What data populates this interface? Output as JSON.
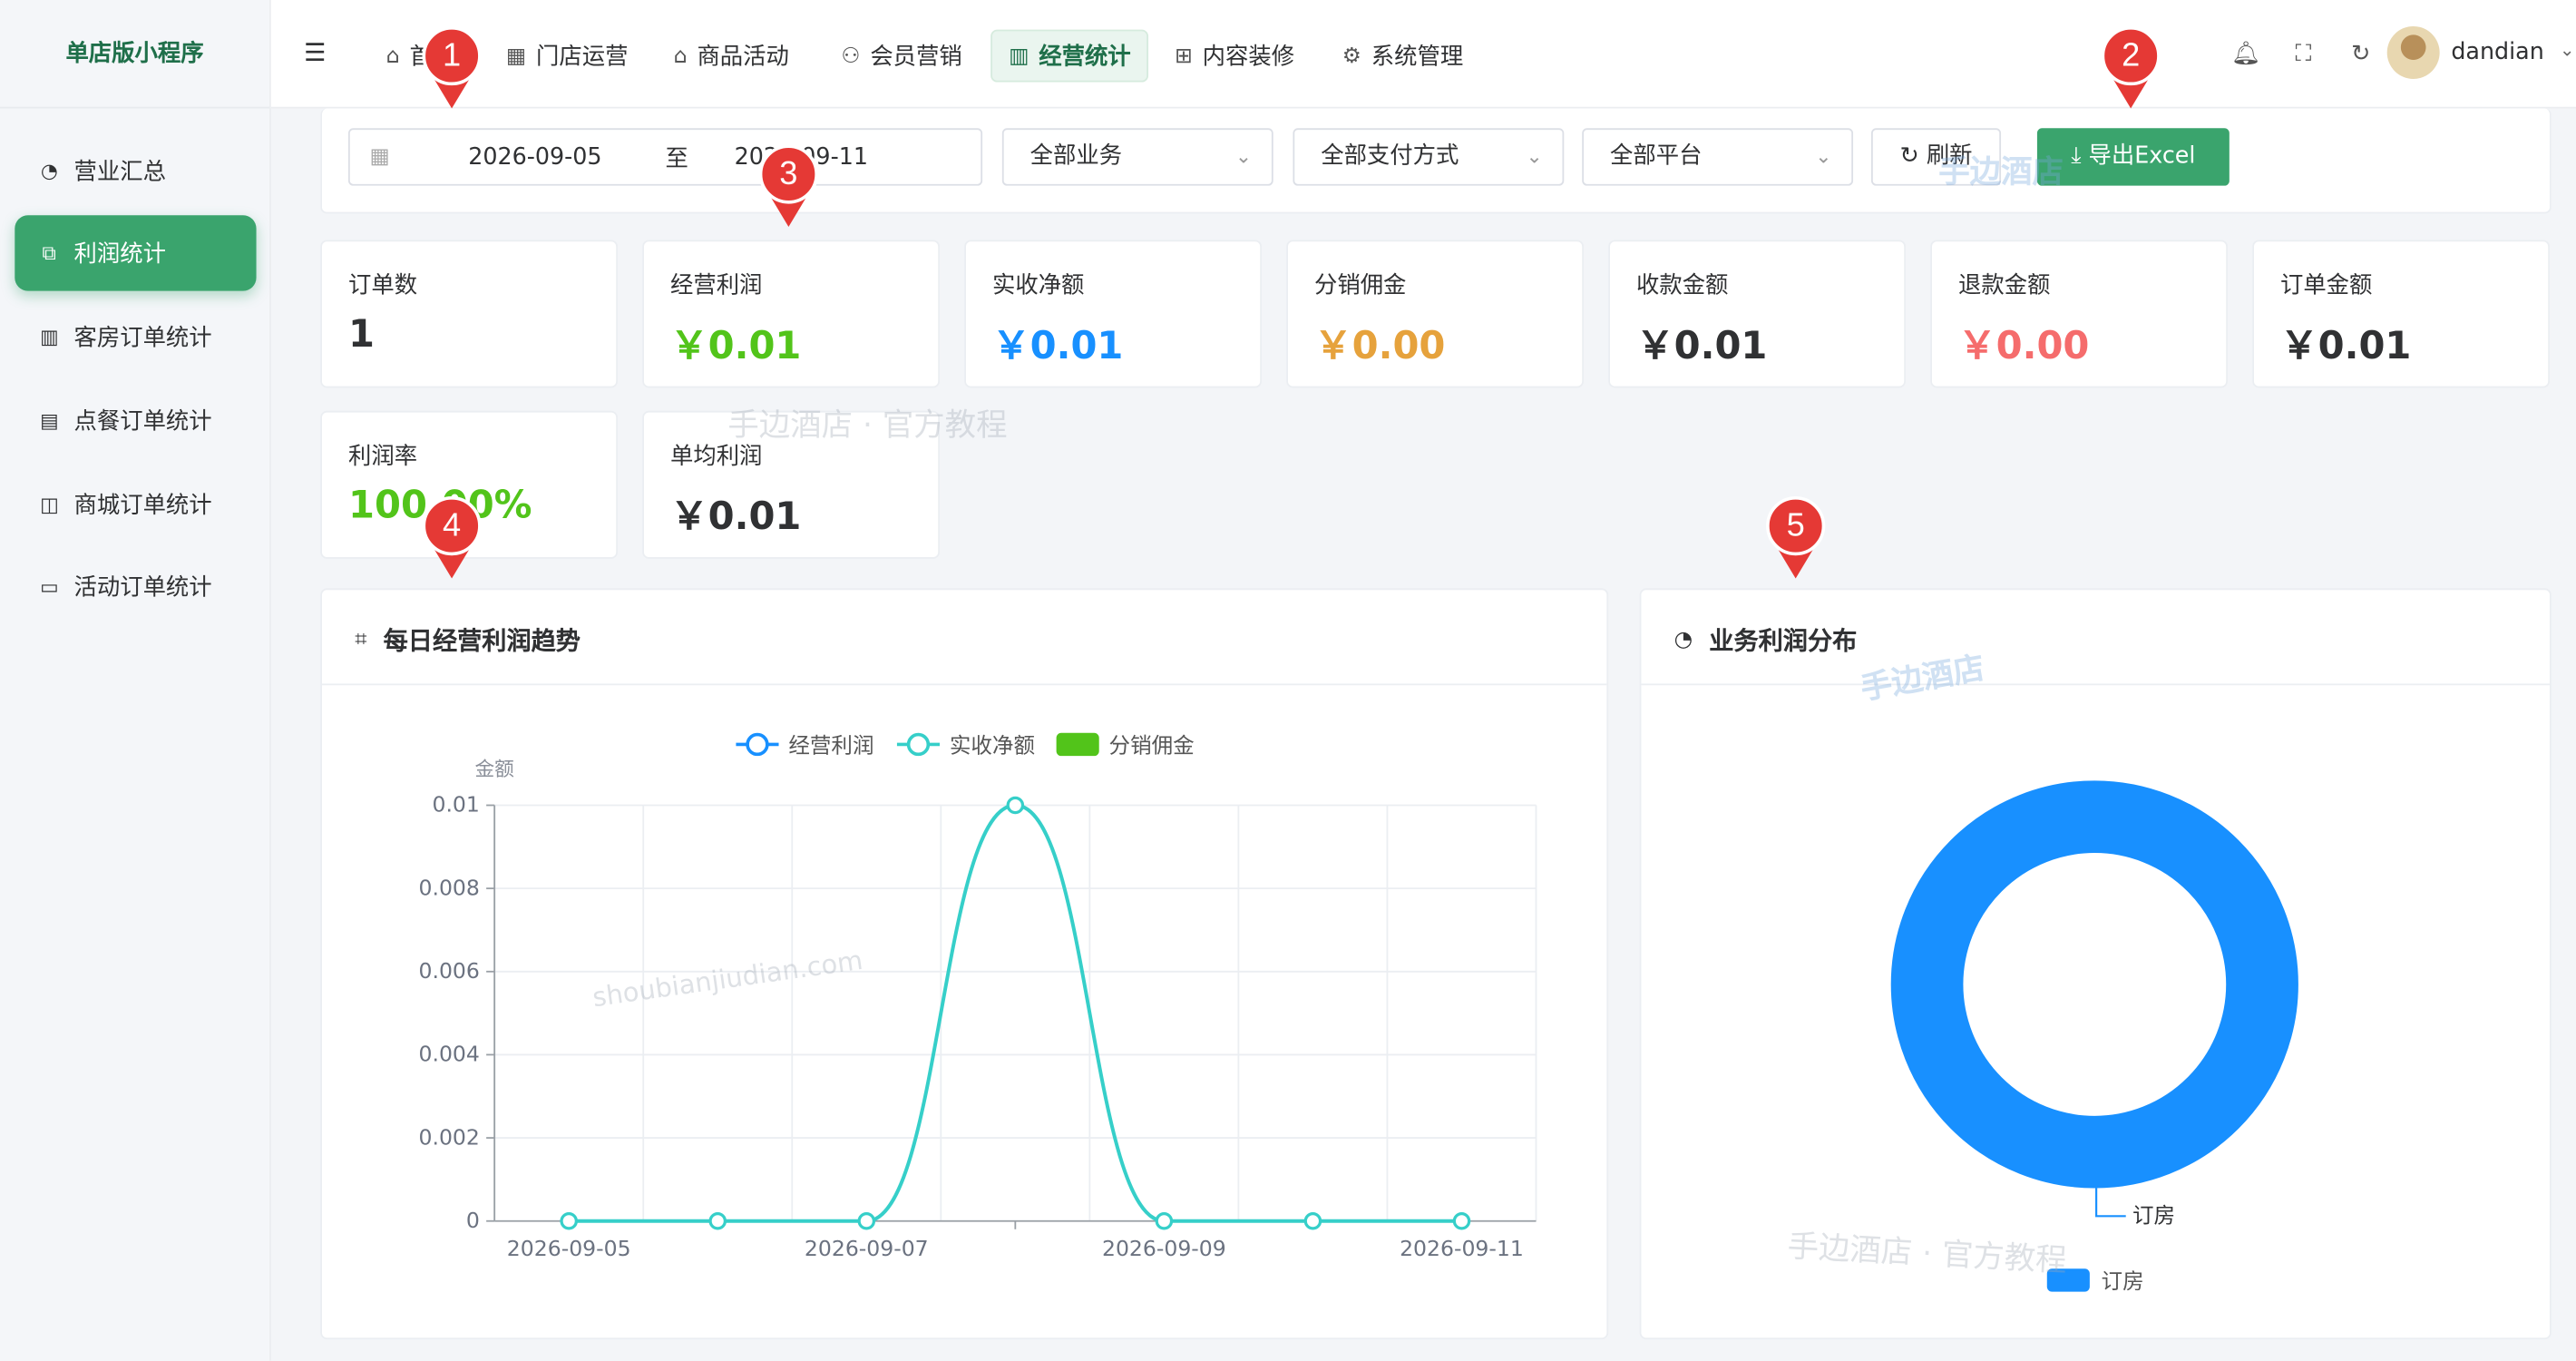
{
  "sidebar": {
    "brand": "单店版小程序",
    "items": [
      {
        "label": "营业汇总",
        "icon": "dashboard-icon"
      },
      {
        "label": "利润统计",
        "icon": "chart-icon",
        "active": true
      },
      {
        "label": "客房订单统计",
        "icon": "bar-chart-icon"
      },
      {
        "label": "点餐订单统计",
        "icon": "food-icon"
      },
      {
        "label": "商城订单统计",
        "icon": "shop-bag-icon"
      },
      {
        "label": "活动订单统计",
        "icon": "clipboard-icon"
      }
    ]
  },
  "topbar": {
    "tabs": [
      {
        "label": "首页",
        "icon": "home-icon"
      },
      {
        "label": "门店运营",
        "icon": "store-icon"
      },
      {
        "label": "商品活动",
        "icon": "shop-icon"
      },
      {
        "label": "会员营销",
        "icon": "user-star-icon"
      },
      {
        "label": "经营统计",
        "icon": "stats-icon",
        "active": true
      },
      {
        "label": "内容装修",
        "icon": "layout-icon"
      },
      {
        "label": "系统管理",
        "icon": "gear-icon"
      }
    ],
    "username": "dandian"
  },
  "filters": {
    "start_date": "2026-09-05",
    "range_sep": "至",
    "end_date": "2026-09-11",
    "business": "全部业务",
    "payment": "全部支付方式",
    "platform": "全部平台",
    "refresh_label": "刷新",
    "export_label": "导出Excel"
  },
  "stats": [
    {
      "label": "订单数",
      "value": "1",
      "color": "#303133"
    },
    {
      "label": "经营利润",
      "value": "￥0.01",
      "color": "#52c41a"
    },
    {
      "label": "实收净额",
      "value": "￥0.01",
      "color": "#1890ff"
    },
    {
      "label": "分销佣金",
      "value": "￥0.00",
      "color": "#e6a23c"
    },
    {
      "label": "收款金额",
      "value": "￥0.01",
      "color": "#303133"
    },
    {
      "label": "退款金额",
      "value": "￥0.00",
      "color": "#f56c6c"
    },
    {
      "label": "订单金额",
      "value": "￥0.01",
      "color": "#303133"
    },
    {
      "label": "利润率",
      "value": "100.00%",
      "color": "#52c41a"
    },
    {
      "label": "单均利润",
      "value": "￥0.01",
      "color": "#303133"
    }
  ],
  "markers": [
    "1",
    "2",
    "3",
    "4",
    "5"
  ],
  "watermarks": [
    "手边酒店",
    "手边酒店 · 官方教程",
    "shoubianjiudian.com",
    "手边酒店",
    "手边酒店 · 官方教程"
  ],
  "panels": {
    "trend_title": "每日经营利润趋势",
    "pie_title": "业务利润分布"
  },
  "chart_data": [
    {
      "type": "line",
      "title": "每日经营利润趋势",
      "ylabel": "金额",
      "ylim": [
        0,
        0.01
      ],
      "yticks": [
        "0",
        "0.002",
        "0.004",
        "0.006",
        "0.008",
        "0.01"
      ],
      "x": [
        "2026-09-05",
        "2026-09-06",
        "2026-09-07",
        "2026-09-08",
        "2026-09-09",
        "2026-09-10",
        "2026-09-11"
      ],
      "xtick_labels": [
        "2026-09-05",
        "2026-09-07",
        "2026-09-09",
        "2026-09-11"
      ],
      "legend": [
        {
          "name": "经营利润",
          "color": "#1890ff",
          "kind": "line"
        },
        {
          "name": "实收净额",
          "color": "#36cfc9",
          "kind": "line"
        },
        {
          "name": "分销佣金",
          "color": "#52c41a",
          "kind": "bar"
        }
      ],
      "series": [
        {
          "name": "实收净额",
          "values": [
            0,
            0,
            0,
            0.01,
            0,
            0,
            0
          ],
          "color": "#36cfc9"
        }
      ],
      "grid": true,
      "legend_position": "top"
    },
    {
      "type": "pie",
      "title": "业务利润分布",
      "categories": [
        "订房"
      ],
      "values": [
        0.01
      ],
      "colors": [
        "#1890ff"
      ],
      "slice_label": "订房",
      "legend": [
        "订房"
      ],
      "legend_position": "bottom"
    }
  ]
}
